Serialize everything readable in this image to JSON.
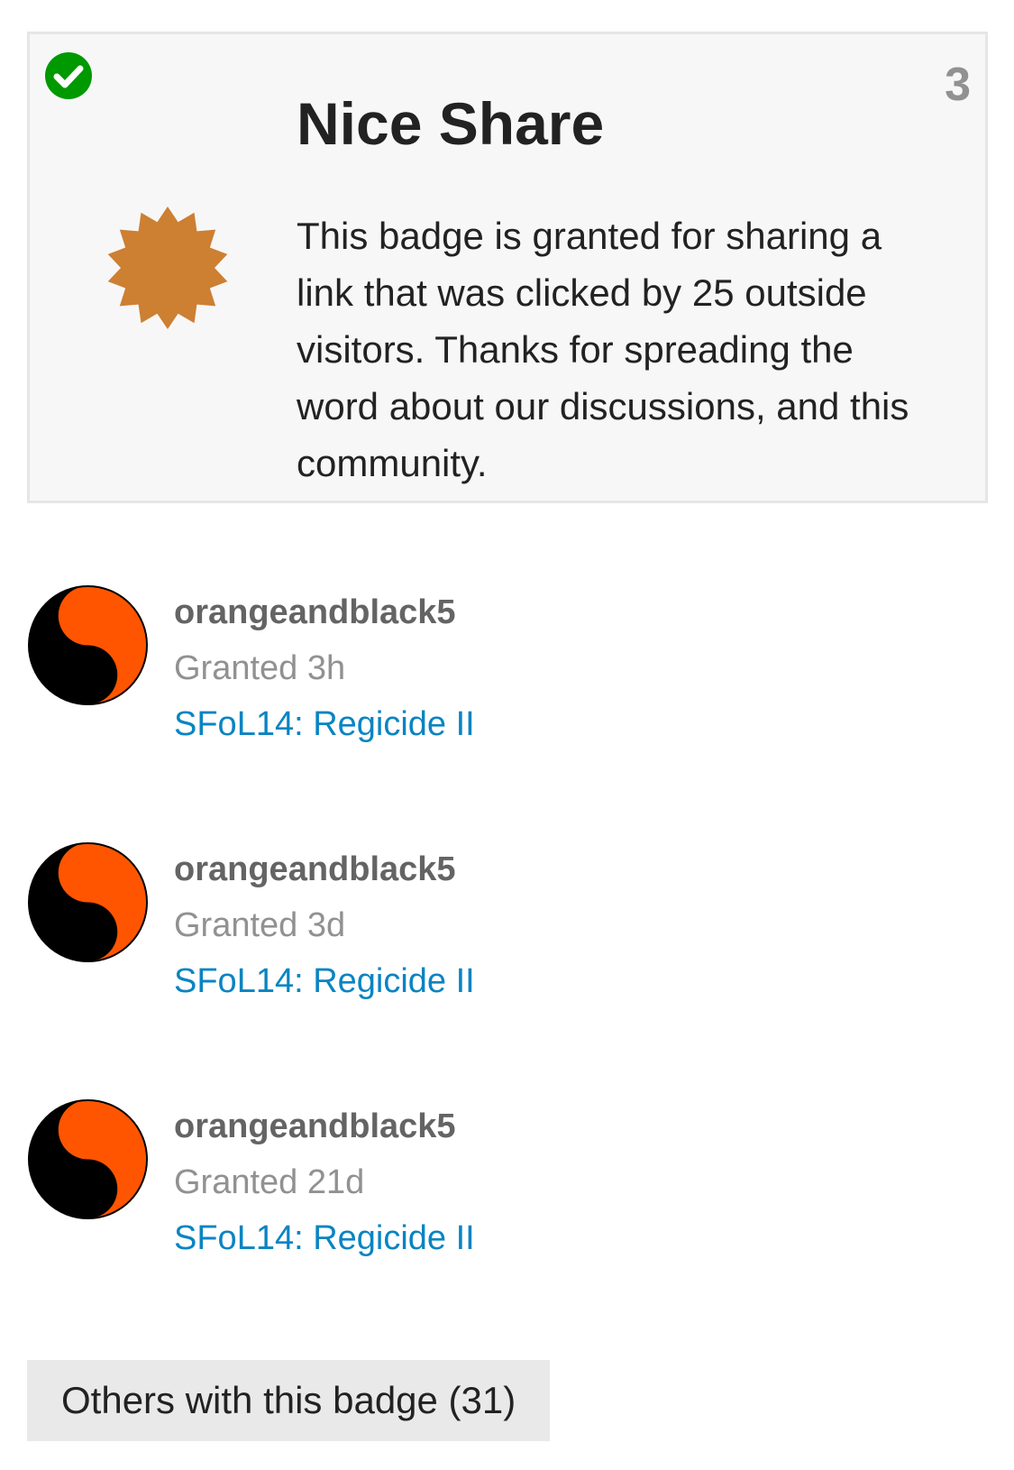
{
  "badge": {
    "title": "Nice Share",
    "description": "This badge is granted for sharing a link that was clicked by 25 outside visitors. Thanks for spreading the word about our discussions, and this community.",
    "grant_count": "3",
    "icon": "bronze-badge-starburst-icon",
    "granted_indicator_icon": "check-circle-icon"
  },
  "grants": [
    {
      "username": "orangeandblack5",
      "granted": "Granted 3h",
      "topic": "SFoL14: Regicide II",
      "avatar_icon": "yin-yang-avatar"
    },
    {
      "username": "orangeandblack5",
      "granted": "Granted 3d",
      "topic": "SFoL14: Regicide II",
      "avatar_icon": "yin-yang-avatar"
    },
    {
      "username": "orangeandblack5",
      "granted": "Granted 21d",
      "topic": "SFoL14: Regicide II",
      "avatar_icon": "yin-yang-avatar"
    }
  ],
  "others_button_label": "Others with this badge (31)",
  "colors": {
    "card_background": "#f7f7f7",
    "card_border": "#e6e6e6",
    "badge_bronze": "#cd7f32",
    "check_green": "#009900",
    "link_blue": "#0a84c2",
    "username_gray": "#646464",
    "muted_gray": "#919191",
    "avatar_orange": "#ff5500",
    "button_background": "#e9e9e9"
  }
}
